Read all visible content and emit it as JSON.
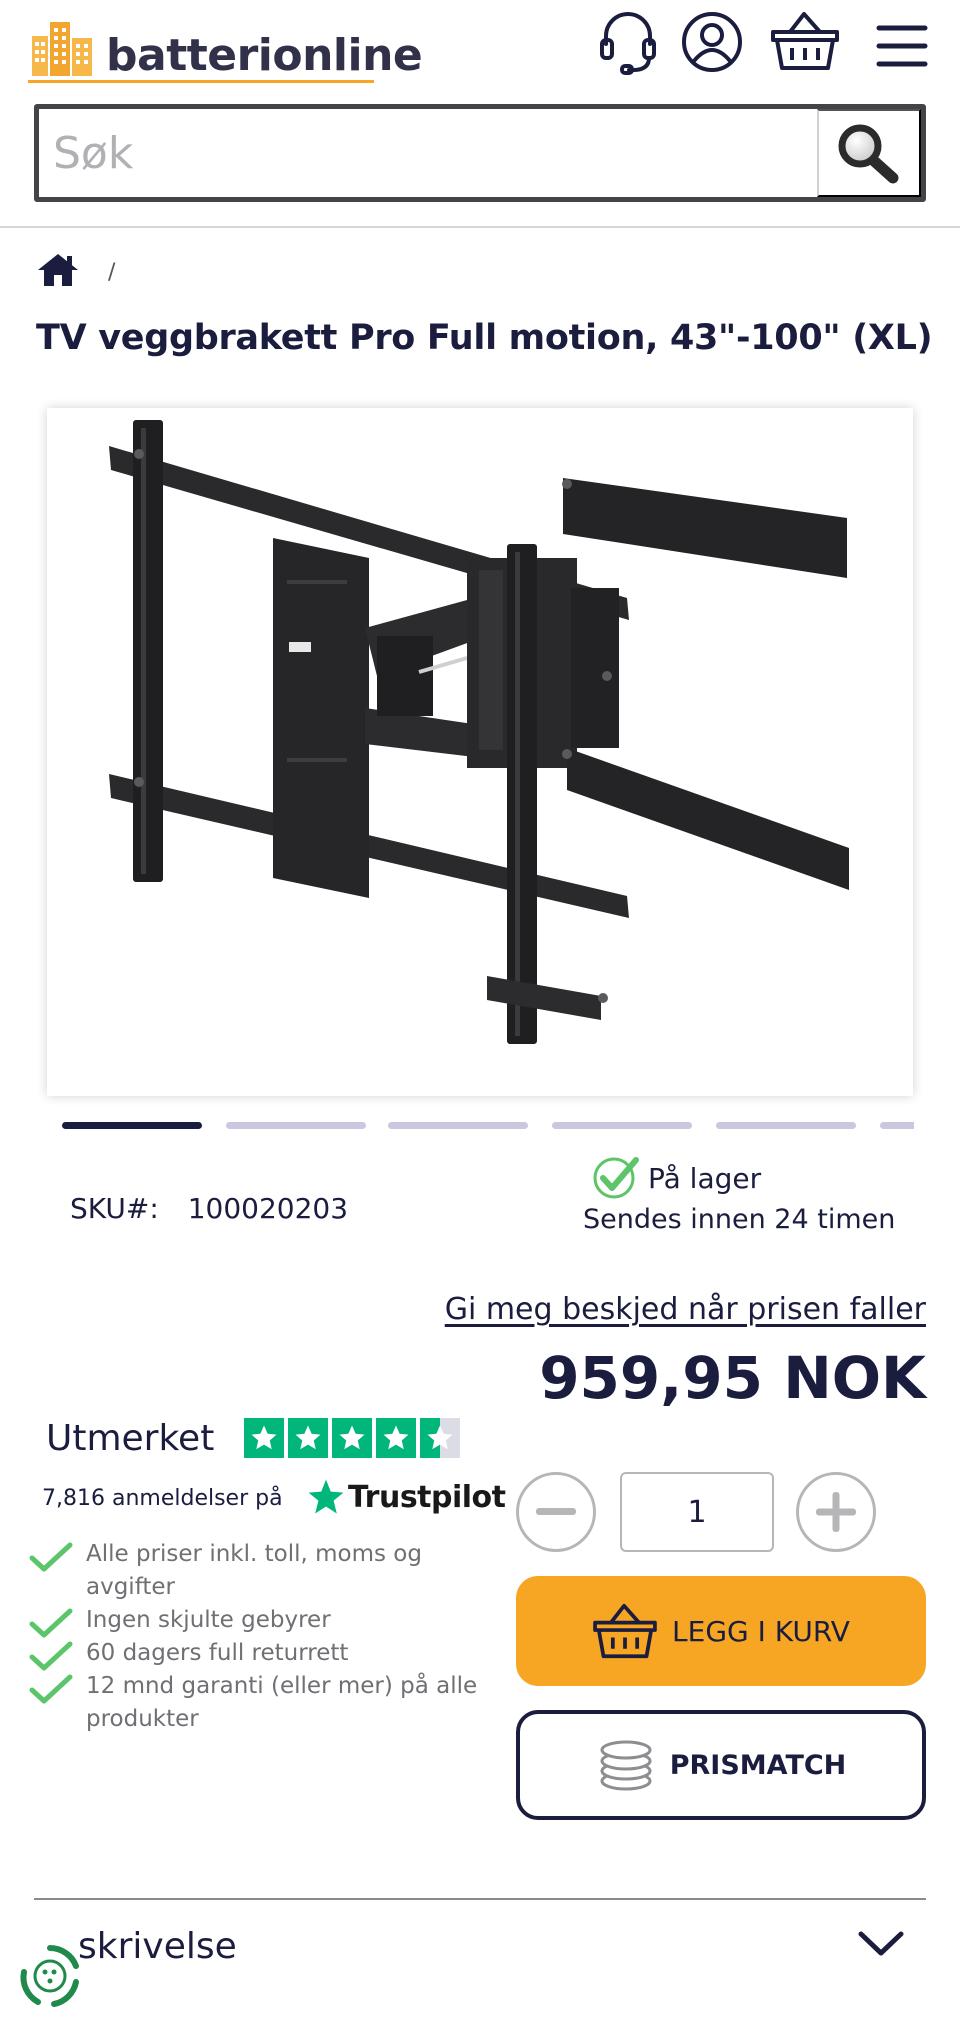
{
  "header": {
    "logo_text": "batterionline",
    "search_placeholder": "Søk"
  },
  "breadcrumb": {
    "separator": "/"
  },
  "product": {
    "title": "TV veggbrakett Pro Full motion, 43\"-100\" (XL)",
    "image_slide_count": 6,
    "active_slide": 1,
    "sku_label": "SKU#:",
    "sku": "100020203",
    "stock_status": "På lager",
    "shipping_info": "Sendes innen 24 timen",
    "price_alert_link": "Gi meg beskjed når prisen faller",
    "price": "959,95 NOK",
    "quantity": "1",
    "add_to_cart_label": "LEGG I KURV",
    "price_match_label": "PRISMATCH"
  },
  "trustpilot": {
    "rating_text": "Utmerket",
    "stars": 4.5,
    "review_count_text": "7,816 anmeldelser på",
    "brand": "Trustpilot"
  },
  "usps": [
    "Alle priser inkl. toll, moms og avgifter",
    "Ingen skjulte gebyrer",
    "60 dagers full returrett",
    "12 mnd garanti (eller mer) på alle produkter"
  ],
  "description": {
    "title": "skrivelse"
  },
  "colors": {
    "primary_navy": "#1b1d3f",
    "accent_orange": "#f6a623",
    "check_green": "#5cc56a",
    "trustpilot_green": "#00b67a"
  }
}
